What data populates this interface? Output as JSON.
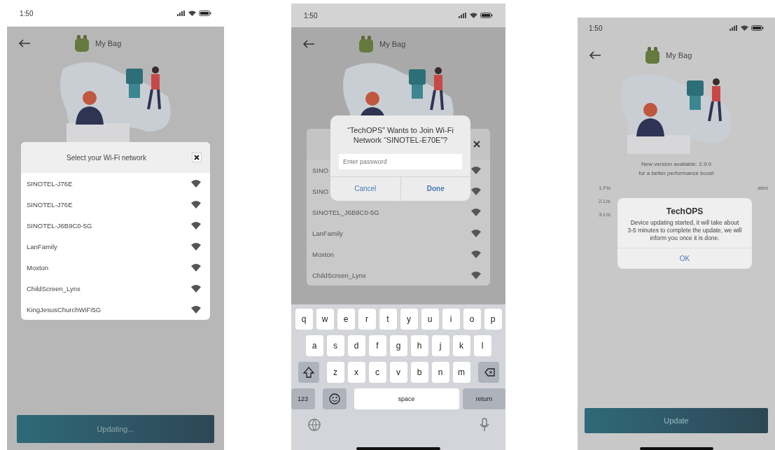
{
  "screens": [
    {
      "kind": "network_picker",
      "status": {
        "time": "1:50"
      },
      "header": {
        "title": "My Bag"
      },
      "picker": {
        "title": "Select your Wi-Fi network",
        "networks": [
          "SINOTEL-J76E",
          "SINOTEL-J76E",
          "SINOTEL-J6B9C0-5G",
          "LanFamily",
          "Moxton",
          "ChildScreen_Lynx",
          "KingJesusChurchWiFi5G"
        ]
      },
      "action": {
        "label": "Updating..."
      }
    },
    {
      "kind": "join_prompt",
      "status": {
        "time": "1:50"
      },
      "header": {
        "title": "My Bag"
      },
      "picker": {
        "networks": [
          "SINO",
          "SINO",
          "SINOTEL_J6B9C0-5G",
          "LanFamily",
          "Moxton",
          "ChildScreen_Lynx"
        ]
      },
      "prompt": {
        "title": "“TechOPS” Wants to Join Wi-Fi Network “SINOTEL-E70E”?",
        "placeholder": "Enter password",
        "buttons": [
          "Cancel",
          "Done"
        ]
      },
      "keyboard": {
        "rows": [
          [
            "q",
            "w",
            "e",
            "r",
            "t",
            "y",
            "u",
            "i",
            "o",
            "p"
          ],
          [
            "a",
            "s",
            "d",
            "f",
            "g",
            "h",
            "j",
            "k",
            "l"
          ],
          [
            "z",
            "x",
            "c",
            "v",
            "b",
            "n",
            "m"
          ]
        ],
        "numbers": "123",
        "space": "space",
        "return": "return"
      }
    },
    {
      "kind": "update_notice",
      "status": {
        "time": "1:50"
      },
      "header": {
        "title": "My Bag"
      },
      "version_lines": [
        "New version available: 2.9.0",
        "for a better performance boost"
      ],
      "notes": [
        {
          "text": "1.Fix",
          "tail": "ates"
        },
        {
          "text": "2.Lis"
        },
        {
          "text": "3.Lis"
        }
      ],
      "alert": {
        "title": "TechOPS",
        "message": "Device updating started, it will take about 3-5 minutes to complete the update, we will inform you once it is done.",
        "button": "OK"
      },
      "action": {
        "label": "Update"
      }
    }
  ]
}
